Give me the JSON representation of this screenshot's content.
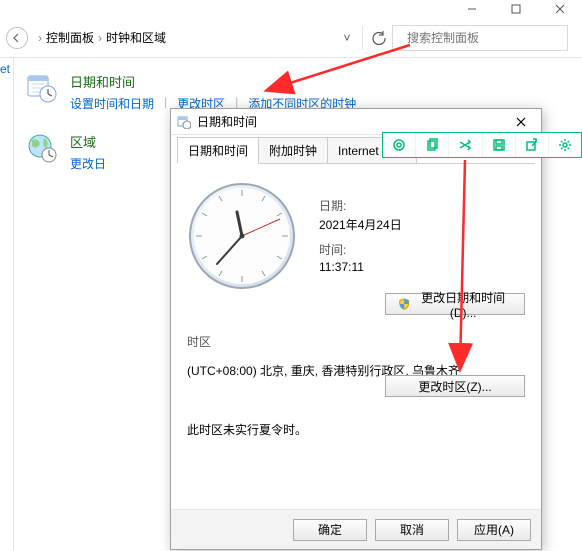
{
  "window_controls": {
    "minimize": "minimize",
    "maximize": "maximize",
    "close": "close"
  },
  "nav": {
    "breadcrumb": [
      "控制面板",
      "时钟和区域"
    ],
    "search_placeholder": "搜索控制面板"
  },
  "sidebar": {
    "home_label": "et"
  },
  "categories": [
    {
      "title": "日期和时间",
      "links": [
        "设置时间和日期",
        "更改时区",
        "添加不同时区的时钟"
      ]
    },
    {
      "title": "区域",
      "links": [
        "更改日"
      ]
    }
  ],
  "dialog": {
    "title": "日期和时间",
    "tabs": [
      "日期和时间",
      "附加时钟",
      "Internet 时间"
    ],
    "active_tab": 0,
    "date_label": "日期:",
    "date_value": "2021年4月24日",
    "time_label": "时间:",
    "time_value": "11:37:11",
    "change_dt_button": "更改日期和时间(D)...",
    "tz_label": "时区",
    "tz_value": "(UTC+08:00) 北京, 重庆, 香港特别行政区, 乌鲁木齐",
    "change_tz_button": "更改时区(Z)...",
    "dst_note": "此时区未实行夏令时。",
    "footer": {
      "ok": "确定",
      "cancel": "取消",
      "apply": "应用(A)"
    }
  },
  "snip_toolbar": {
    "items": [
      "ocr",
      "copy",
      "shuffle",
      "save",
      "share",
      "settings"
    ]
  },
  "clock": {
    "hour": 11,
    "minute": 37,
    "second": 11
  }
}
